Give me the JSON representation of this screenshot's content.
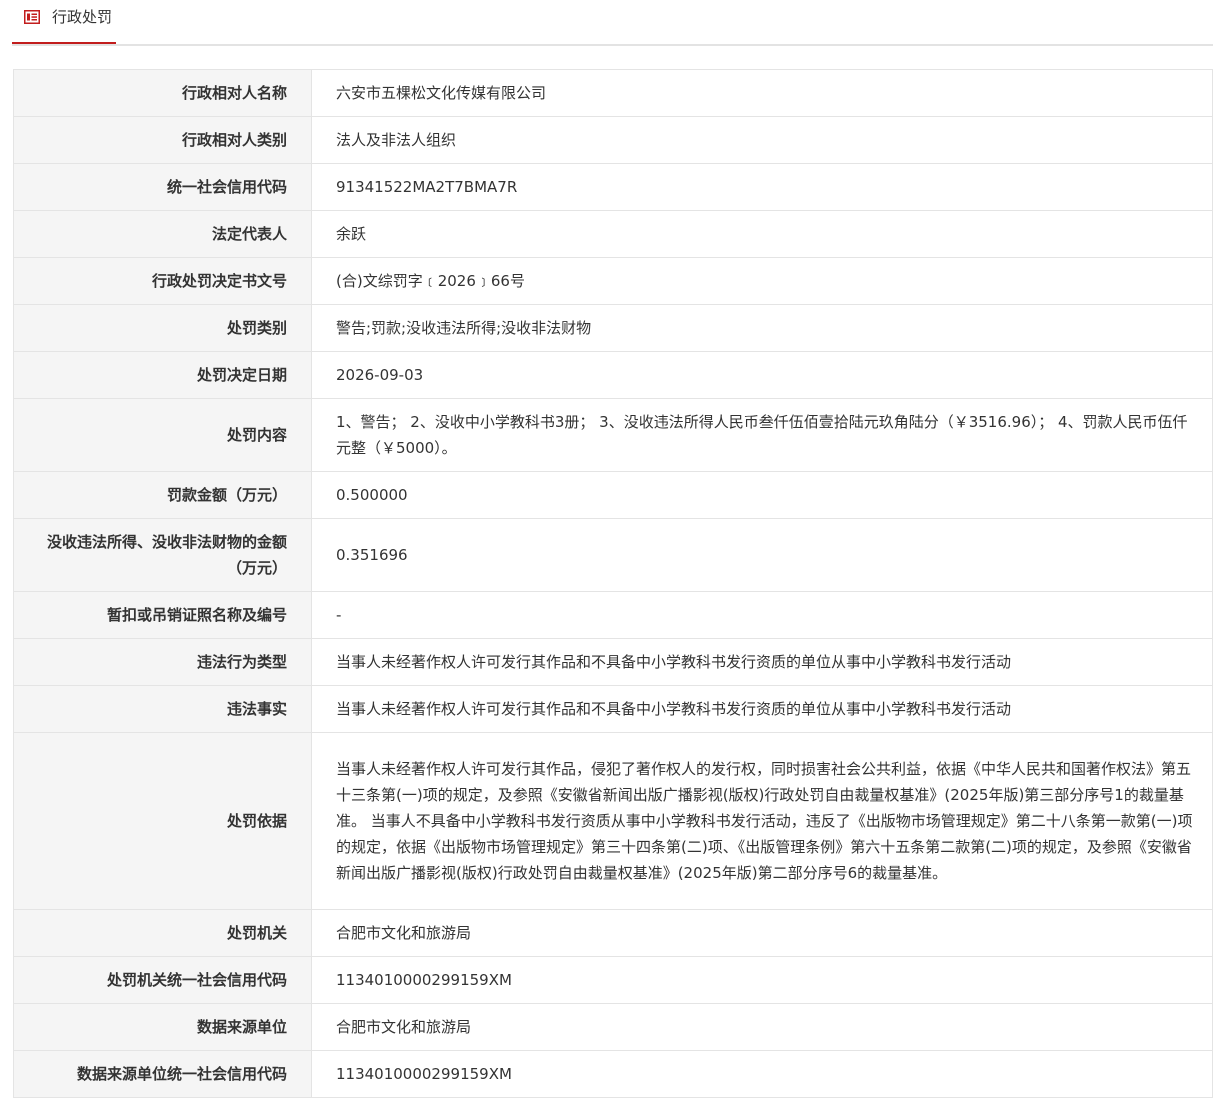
{
  "header": {
    "title": "行政处罚",
    "icon": "document-icon",
    "accent": "#c21d1d"
  },
  "rows": [
    {
      "label": "行政相对人名称",
      "value": "六安市五棵松文化传媒有限公司"
    },
    {
      "label": "行政相对人类别",
      "value": "法人及非法人组织"
    },
    {
      "label": "统一社会信用代码",
      "value": "91341522MA2T7BMA7R"
    },
    {
      "label": "法定代表人",
      "value": "余跃"
    },
    {
      "label": "行政处罚决定书文号",
      "value": "(合)文综罚字﹝2026﹞66号"
    },
    {
      "label": "处罚类别",
      "value": "警告;罚款;没收违法所得;没收非法财物"
    },
    {
      "label": "处罚决定日期",
      "value": "2026-09-03"
    },
    {
      "label": "处罚内容",
      "value": "1、警告； 2、没收中小学教科书3册； 3、没收违法所得人民币叁仟伍佰壹拾陆元玖角陆分（￥3516.96）； 4、罚款人民币伍仟元整（￥5000）。"
    },
    {
      "label": "罚款金额（万元）",
      "value": "0.500000"
    },
    {
      "label": "没收违法所得、没收非法财物的金额（万元）",
      "value": "0.351696"
    },
    {
      "label": "暂扣或吊销证照名称及编号",
      "value": "-"
    },
    {
      "label": "违法行为类型",
      "value": "当事人未经著作权人许可发行其作品和不具备中小学教科书发行资质的单位从事中小学教科书发行活动"
    },
    {
      "label": "违法事实",
      "value": "当事人未经著作权人许可发行其作品和不具备中小学教科书发行资质的单位从事中小学教科书发行活动"
    },
    {
      "label": "处罚依据",
      "value": "当事人未经著作权人许可发行其作品，侵犯了著作权人的发行权，同时损害社会公共利益，依据《中华人民共和国著作权法》第五十三条第(一)项的规定，及参照《安徽省新闻出版广播影视(版权)行政处罚自由裁量权基准》(2025年版)第三部分序号1的裁量基准。 当事人不具备中小学教科书发行资质从事中小学教科书发行活动，违反了《出版物市场管理规定》第二十八条第一款第(一)项的规定，依据《出版物市场管理规定》第三十四条第(二)项、《出版管理条例》第六十五条第二款第(二)项的规定，及参照《安徽省新闻出版广播影视(版权)行政处罚自由裁量权基准》(2025年版)第二部分序号6的裁量基准。"
    },
    {
      "label": "处罚机关",
      "value": "合肥市文化和旅游局"
    },
    {
      "label": "处罚机关统一社会信用代码",
      "value": "11340100002991​59XM"
    },
    {
      "label": "数据来源单位",
      "value": "合肥市文化和旅游局"
    },
    {
      "label": "数据来源单位统一社会信用代码",
      "value": "11340100002991​59XM"
    }
  ]
}
